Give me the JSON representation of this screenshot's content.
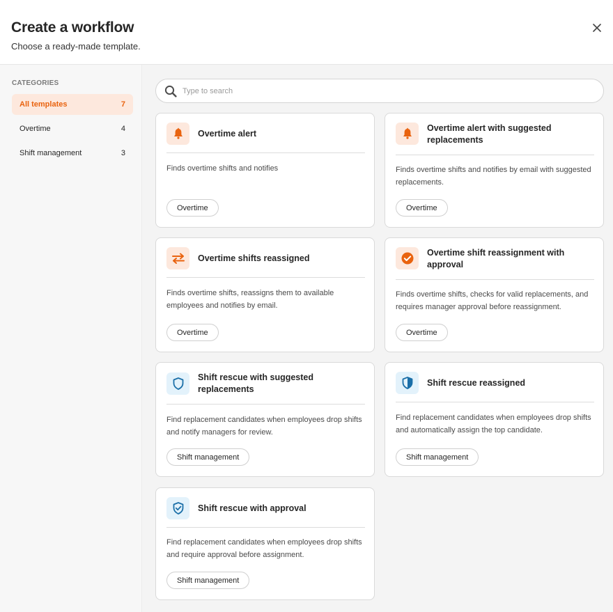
{
  "header": {
    "title": "Create a workflow",
    "subtitle": "Choose a ready-made template."
  },
  "sidebar": {
    "heading": "CATEGORIES",
    "items": [
      {
        "label": "All templates",
        "count": "7",
        "active": true
      },
      {
        "label": "Overtime",
        "count": "4",
        "active": false
      },
      {
        "label": "Shift management",
        "count": "3",
        "active": false
      }
    ]
  },
  "search": {
    "placeholder": "Type to search",
    "value": ""
  },
  "colors": {
    "accent_orange": "#e9630f",
    "accent_orange_bg": "#fde8dd",
    "accent_blue": "#1b6fa8",
    "accent_blue_bg": "#e3f2fb"
  },
  "cards": [
    {
      "title": "Overtime alert",
      "description": "Finds overtime shifts and notifies",
      "tag": "Overtime",
      "icon": "bell-icon"
    },
    {
      "title": "Overtime alert with suggested replacements",
      "description": "Finds overtime shifts and notifies by email with suggested replacements.",
      "tag": "Overtime",
      "icon": "bell-icon"
    },
    {
      "title": "Overtime shifts reassigned",
      "description": "Finds overtime shifts, reassigns them to available employees and notifies by email.",
      "tag": "Overtime",
      "icon": "swap-arrows-icon"
    },
    {
      "title": "Overtime shift reassignment with approval",
      "description": "Finds overtime shifts, checks for valid replacements, and requires manager approval before reassignment.",
      "tag": "Overtime",
      "icon": "check-circle-icon"
    },
    {
      "title": "Shift rescue with suggested replacements",
      "description": "Find replacement candidates when employees drop shifts and notify managers for review.",
      "tag": "Shift management",
      "icon": "shield-outline-icon"
    },
    {
      "title": "Shift rescue reassigned",
      "description": "Find replacement candidates when employees drop shifts and automatically assign the top candidate.",
      "tag": "Shift management",
      "icon": "shield-half-icon"
    },
    {
      "title": "Shift rescue with approval",
      "description": "Find replacement candidates when employees drop shifts and require approval before assignment.",
      "tag": "Shift management",
      "icon": "shield-check-icon"
    }
  ]
}
